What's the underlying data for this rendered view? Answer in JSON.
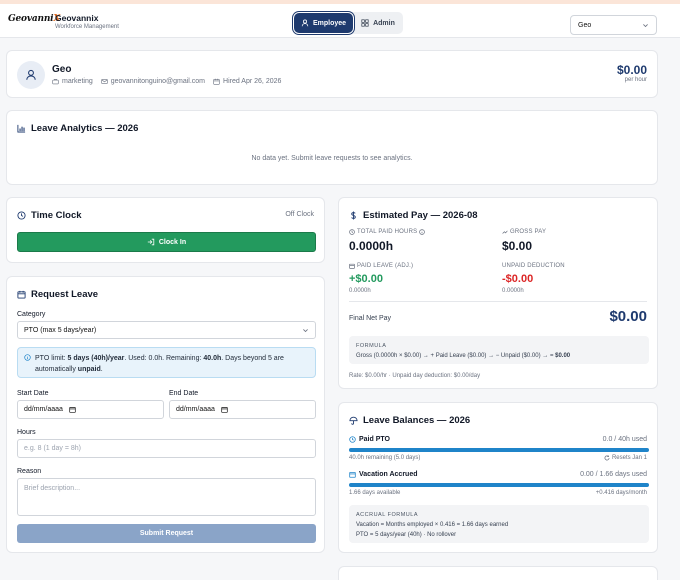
{
  "app": {
    "logo_main": "Geovanni",
    "logo_x": "X",
    "name": "Geovannix",
    "subtitle": "Workforce Management"
  },
  "modes": [
    {
      "label": "Employee",
      "active": true
    },
    {
      "label": "Admin",
      "active": false
    }
  ],
  "user_select": {
    "value": "Geo"
  },
  "profile": {
    "name": "Geo",
    "department": "marketing",
    "email": "geovannitonguino@gmail.com",
    "hired": "Hired Apr 26, 2026",
    "rate": "$0.00",
    "rate_unit": "per hour"
  },
  "analytics": {
    "title": "Leave Analytics — 2026",
    "empty": "No data yet. Submit leave requests to see analytics."
  },
  "time_clock": {
    "title": "Time Clock",
    "status": "Off Clock",
    "button": "Clock In"
  },
  "request_leave": {
    "title": "Request Leave",
    "category_label": "Category",
    "category_value": "PTO (max 5 days/year)",
    "info_prefix": "PTO limit: ",
    "info_limit": "5 days (40h)/year",
    "info_mid": ". Used: 0.0h. Remaining: ",
    "info_remaining": "40.0h",
    "info_suffix": ". Days beyond 5 are automatically ",
    "info_unpaid": "unpaid",
    "info_end": ".",
    "start_label": "Start Date",
    "start_value": "dd/mm/aaaa",
    "end_label": "End Date",
    "end_value": "dd/mm/aaaa",
    "hours_label": "Hours",
    "hours_placeholder": "e.g. 8 (1 day = 8h)",
    "reason_label": "Reason",
    "reason_placeholder": "Brief description...",
    "submit": "Submit Request"
  },
  "estimated_pay": {
    "title": "Estimated Pay — 2026-08",
    "total_paid_label": "TOTAL PAID HOURS",
    "total_paid_value": "0.0000h",
    "gross_label": "GROSS PAY",
    "gross_value": "$0.00",
    "paid_leave_label": "PAID LEAVE (ADJ.)",
    "paid_leave_value": "+$0.00",
    "paid_leave_sub": "0.0000h",
    "unpaid_label": "UNPAID DEDUCTION",
    "unpaid_value": "-$0.00",
    "unpaid_sub": "0.0000h",
    "net_label": "Final Net Pay",
    "net_value": "$0.00",
    "formula_title": "FORMULA",
    "formula_text": "Gross (0.0000h × $0.00) → + Paid Leave ($0.00) → − Unpaid ($0.00) → = ",
    "formula_result": "$0.00",
    "footer": "Rate: $0.00/hr · Unpaid day deduction: $0.00/day"
  },
  "leave_balances": {
    "title": "Leave Balances — 2026",
    "paid_pto_label": "Paid PTO",
    "paid_pto_used": "0.0 / 40h used",
    "paid_pto_fill": 1.0,
    "paid_pto_remaining": "40.0h remaining (5.0 days)",
    "paid_pto_reset": "Resets Jan 1",
    "vacation_label": "Vacation Accrued",
    "vacation_used": "0.00 / 1.66 days used",
    "vacation_fill": 1.0,
    "vacation_available": "1.66 days available",
    "vacation_rate": "+0.416 days/month",
    "accrual_title": "ACCRUAL FORMULA",
    "accrual_line1": "Vacation = Months employed × 0.416 = 1.66 days earned",
    "accrual_line2": "PTO = 5 days/year (40h) · No rollover"
  },
  "colors": {
    "navy": "#1e3a6e",
    "green": "#239a5e",
    "red": "#dc2626",
    "bar_blue": "#1f84c9"
  }
}
